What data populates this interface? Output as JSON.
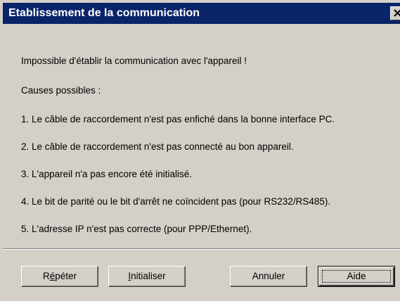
{
  "dialog": {
    "title": "Etablissement de la communication",
    "close_icon": "close-icon",
    "colors": {
      "titlebar": "#0a246a",
      "face": "#d4d0c8"
    }
  },
  "message": {
    "headline": "Impossible d'établir la communication avec l'appareil !",
    "causes_label": "Causes possibles :",
    "causes": [
      "1. Le câble de raccordement n'est pas enfiché dans la bonne interface PC.",
      "2. Le câble de raccordement n'est pas connecté au bon appareil.",
      "3. L'appareil n'a pas encore été initialisé.",
      "4. Le bit de parité ou le bit d'arrêt ne coïncident pas (pour RS232/RS485).",
      "5. L'adresse IP n'est pas correcte (pour PPP/Ethernet)."
    ]
  },
  "buttons": {
    "repeat": {
      "first": "R",
      "mnemonic": "é",
      "rest": "péter"
    },
    "initialize": {
      "first": "",
      "mnemonic": "I",
      "rest": "nitialiser"
    },
    "cancel": "Annuler",
    "help": "Aide"
  }
}
